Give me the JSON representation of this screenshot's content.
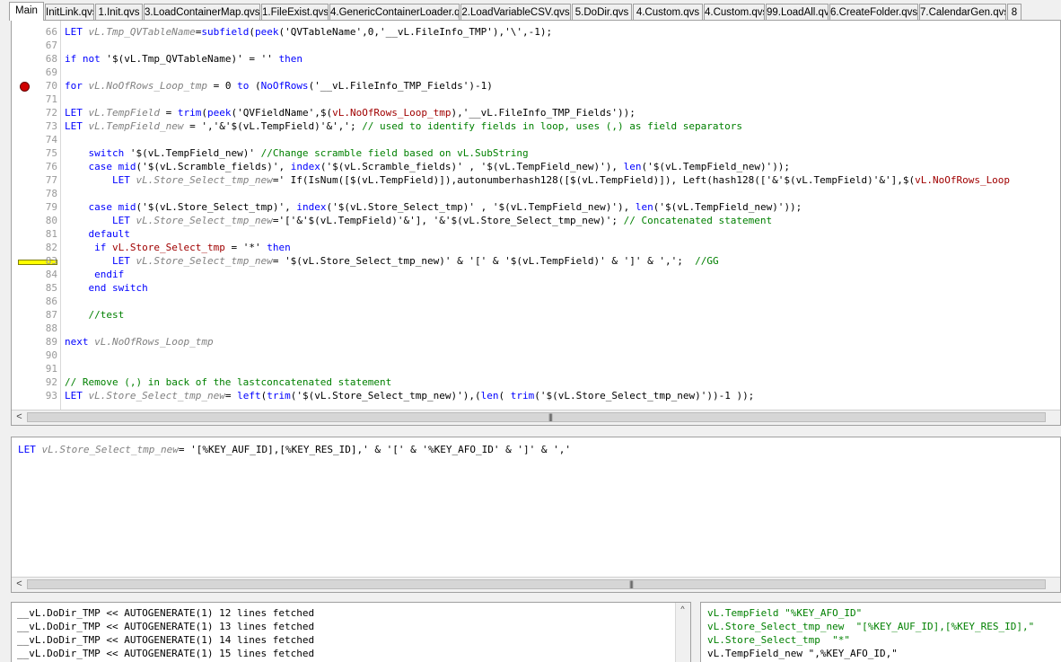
{
  "tabs": [
    {
      "label": "Main",
      "active": true
    },
    {
      "label": "InitLink.qvs",
      "active": false
    },
    {
      "label": "1.Init.qvs",
      "active": false
    },
    {
      "label": "3.LoadContainerMap.qvs",
      "active": false
    },
    {
      "label": "1.FileExist.qvs",
      "active": false
    },
    {
      "label": "4.GenericContainerLoader.qvs",
      "active": false
    },
    {
      "label": "2.LoadVariableCSV.qvs",
      "active": false
    },
    {
      "label": "5.DoDir.qvs",
      "active": false
    },
    {
      "label": "4.Custom.qvs",
      "active": false
    },
    {
      "label": "4.Custom.qvs",
      "active": false
    },
    {
      "label": "99.LoadAll.qvs",
      "active": false
    },
    {
      "label": "6.CreateFolder.qvs",
      "active": false
    },
    {
      "label": "7.CalendarGen.qvs",
      "active": false
    },
    {
      "label": "8",
      "active": false
    }
  ],
  "editor": {
    "line_numbers": [
      "66",
      "67",
      "68",
      "69",
      "70",
      "71",
      "72",
      "73",
      "74",
      "75",
      "76",
      "77",
      "78",
      "79",
      "80",
      "81",
      "82",
      "83",
      "84",
      "85",
      "86",
      "87",
      "88",
      "89",
      "90",
      "91",
      "92",
      "93"
    ],
    "breakpoint_line": "70",
    "current_line": "83",
    "lines": [
      "LET vL.Tmp_QVTableName=subfield(peek('QVTableName',0,'__vL.FileInfo_TMP'),'\\',-1);",
      "",
      "if not '$(vL.Tmp_QVTableName)' = '' then",
      "",
      "for vL.NoOfRows_Loop_tmp = 0 to (NoOfRows('__vL.FileInfo_TMP_Fields')-1)",
      "",
      "LET vL.TempField = trim(peek('QVFieldName',$(vL.NoOfRows_Loop_tmp),'__vL.FileInfo_TMP_Fields'));",
      "LET vL.TempField_new = ','&'$(vL.TempField)'&','; // used to identify fields in loop, uses (,) as field separators",
      "",
      "    switch '$(vL.TempField_new)' //Change scramble field based on vL.SubString",
      "    case mid('$(vL.Scramble_fields)', index('$(vL.Scramble_fields)' , '$(vL.TempField_new)'), len('$(vL.TempField_new)'));",
      "        LET vL.Store_Select_tmp_new=' If(IsNum([$(vL.TempField)]),autonumberhash128([$(vL.TempField)]), Left(hash128(['&'$(vL.TempField)'&'],$(vL.NoOfRows_Loop",
      "",
      "    case mid('$(vL.Store_Select_tmp)', index('$(vL.Store_Select_tmp)' , '$(vL.TempField_new)'), len('$(vL.TempField_new)'));",
      "        LET vL.Store_Select_tmp_new='['&'$(vL.TempField)'&'], '&'$(vL.Store_Select_tmp_new)'; // Concatenated statement",
      "    default",
      "     if vL.Store_Select_tmp = '*' then",
      "        LET vL.Store_Select_tmp_new= '$(vL.Store_Select_tmp_new)' & '[' & '$(vL.TempField)' & ']' & ',';  //GG",
      "     endif",
      "    end switch",
      "",
      "    //test",
      "",
      "next vL.NoOfRows_Loop_tmp",
      "",
      "",
      "// Remove (,) in back of the lastconcatenated statement",
      "LET vL.Store_Select_tmp_new= left(trim('$(vL.Store_Select_tmp_new)'),(len( trim('$(vL.Store_Select_tmp_new)'))-1 ));"
    ]
  },
  "evaluation": {
    "text": "LET vL.Store_Select_tmp_new= '[%KEY_AUF_ID],[%KEY_RES_ID],' & '[' & '%KEY_AFO_ID' & ']' & ','"
  },
  "log": {
    "lines": [
      "__vL.DoDir_TMP << AUTOGENERATE(1) 12 lines fetched",
      "__vL.DoDir_TMP << AUTOGENERATE(1) 13 lines fetched",
      "__vL.DoDir_TMP << AUTOGENERATE(1) 14 lines fetched",
      "__vL.DoDir_TMP << AUTOGENERATE(1) 15 lines fetched"
    ]
  },
  "variables": {
    "lines": [
      "vL.TempField \"%KEY_AFO_ID\"",
      "vL.Store_Select_tmp_new  \"[%KEY_AUF_ID],[%KEY_RES_ID],\"",
      "vL.Store_Select_tmp  \"*\"",
      "vL.TempField_new \",%KEY_AFO_ID,\""
    ]
  },
  "scrollbar": {
    "left_arrow": "<",
    "up_arrow": "^",
    "grip": "|||"
  }
}
